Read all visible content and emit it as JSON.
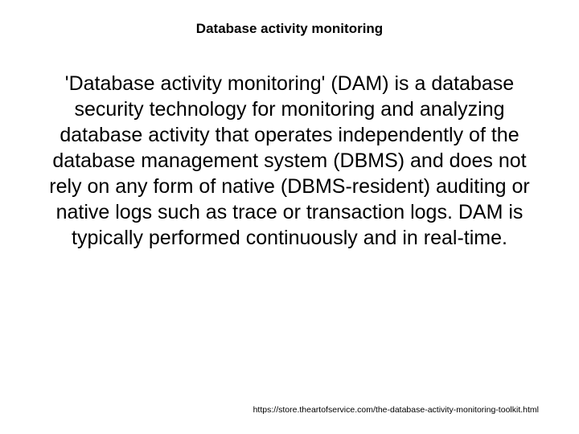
{
  "slide": {
    "title": "Database activity monitoring",
    "body": " 'Database activity monitoring' (DAM) is a database security technology for monitoring and analyzing database activity that operates independently of the database management system (DBMS) and does not rely on any form of native (DBMS-resident) auditing or native logs such as trace or transaction logs. DAM is typically performed continuously and in real-time.",
    "footer_link": "https://store.theartofservice.com/the-database-activity-monitoring-toolkit.html"
  }
}
